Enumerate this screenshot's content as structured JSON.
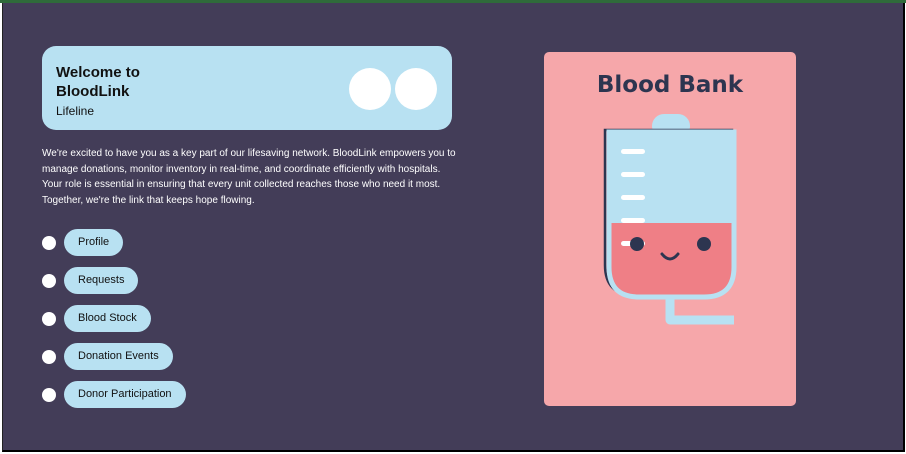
{
  "welcome": {
    "title": "Welcome to BloodLink",
    "subtitle": "Lifeline"
  },
  "intro_text": "We're excited to have you as a key part of our lifesaving network. BloodLink empowers you to manage donations, monitor inventory in real-time, and coordinate efficiently with hospitals. Your role is essential in ensuring that every unit collected reaches those who need it most. Together, we're the link that keeps hope flowing.",
  "menu": {
    "items": [
      {
        "label": "Profile"
      },
      {
        "label": "Requests"
      },
      {
        "label": "Blood Stock"
      },
      {
        "label": "Donation Events"
      },
      {
        "label": "Donor Participation"
      }
    ]
  },
  "poster": {
    "title": "Blood Bank",
    "illustration": "blood-bag-icon"
  },
  "colors": {
    "background": "#433d58",
    "card": "#b8e1f2",
    "poster": "#f6a7aa",
    "blood": "#ef7f86",
    "navy": "#2d3550"
  }
}
